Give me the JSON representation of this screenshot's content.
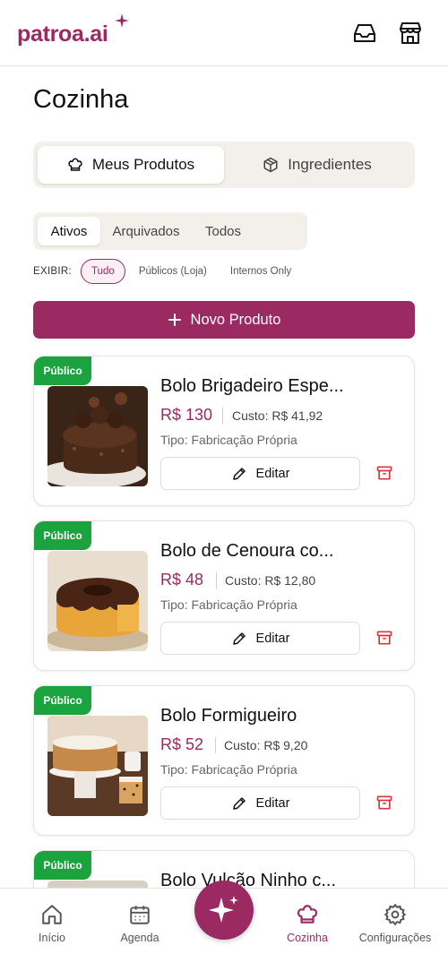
{
  "header": {
    "logo_text": "patroa.ai",
    "icons": [
      "inbox-icon",
      "store-icon"
    ]
  },
  "page": {
    "title": "Cozinha"
  },
  "segment": {
    "tabs": [
      {
        "label": "Meus Produtos",
        "icon": "chef-hat-icon",
        "active": true
      },
      {
        "label": "Ingredientes",
        "icon": "box-icon",
        "active": false
      }
    ]
  },
  "status_filter": {
    "options": [
      {
        "label": "Ativos",
        "active": true
      },
      {
        "label": "Arquivados",
        "active": false
      },
      {
        "label": "Todos",
        "active": false
      }
    ]
  },
  "exibir": {
    "label": "EXIBIR:",
    "chips": [
      {
        "label": "Tudo",
        "active": true
      },
      {
        "label": "Públicos (Loja)",
        "active": false
      },
      {
        "label": "Internos Only",
        "active": false
      }
    ]
  },
  "new_product": {
    "label": "Novo Produto"
  },
  "products": [
    {
      "badge": "Público",
      "name": "Bolo Brigadeiro Espe...",
      "price": "R$ 130",
      "cost": "Custo: R$ 41,92",
      "type": "Tipo: Fabricação Própria",
      "edit_label": "Editar",
      "image": "chocolate-cake"
    },
    {
      "badge": "Público",
      "name": "Bolo de Cenoura co...",
      "price": "R$ 48",
      "cost": "Custo: R$ 12,80",
      "type": "Tipo: Fabricação Própria",
      "edit_label": "Editar",
      "image": "carrot-cake"
    },
    {
      "badge": "Público",
      "name": "Bolo Formigueiro",
      "price": "R$ 52",
      "cost": "Custo: R$ 9,20",
      "type": "Tipo: Fabricação Própria",
      "edit_label": "Editar",
      "image": "sprinkle-cake"
    },
    {
      "badge": "Público",
      "name": "Bolo Vulcão Ninho c...",
      "price": "",
      "cost": "",
      "type": "",
      "edit_label": "",
      "image": "volcano-cake"
    }
  ],
  "bottom_nav": {
    "items": [
      {
        "label": "Início",
        "icon": "home-icon",
        "active": false
      },
      {
        "label": "Agenda",
        "icon": "calendar-icon",
        "active": false
      },
      {
        "label": "Cozinha",
        "icon": "chef-hat-icon",
        "active": true
      },
      {
        "label": "Configurações",
        "icon": "gear-icon",
        "active": false
      }
    ],
    "fab_icon": "sparkle-icon"
  },
  "colors": {
    "brand": "#9b2a62",
    "badge_green": "#1aa33f",
    "archive_red": "#d9363e"
  }
}
